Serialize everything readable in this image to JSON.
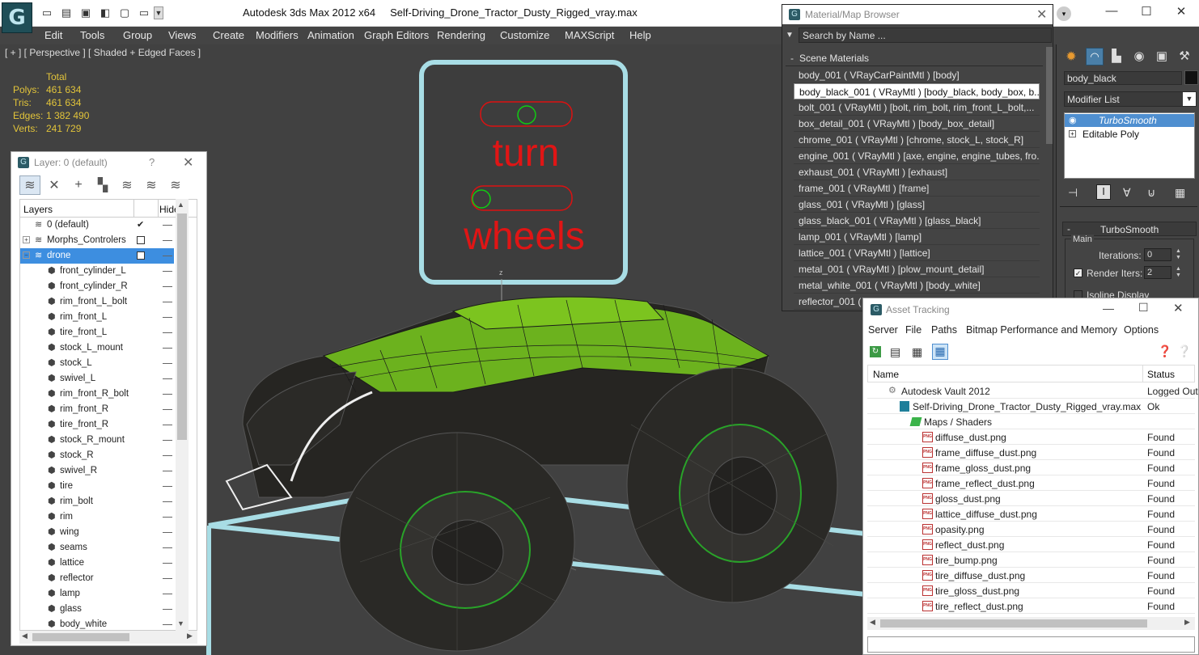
{
  "titlebar": {
    "app_title": "Autodesk 3ds Max  2012 x64",
    "file_name": "Self-Driving_Drone_Tractor_Dusty_Rigged_vray.max"
  },
  "menu": [
    "Edit",
    "Tools",
    "Group",
    "Views",
    "Create",
    "Modifiers",
    "Animation",
    "Graph Editors",
    "Rendering",
    "Customize",
    "MAXScript",
    "Help"
  ],
  "viewport": {
    "label": "[ + ] [ Perspective ] [ Shaded + Edged Faces ]",
    "stats_header": "Total",
    "stats": [
      {
        "label": "Polys:",
        "value": "461 634"
      },
      {
        "label": "Tris:",
        "value": "461 634"
      },
      {
        "label": "Edges:",
        "value": "1 382 490"
      },
      {
        "label": "Verts:",
        "value": "241 729"
      }
    ],
    "sign_line1": "turn",
    "sign_line2": "wheels",
    "axis_label": "z"
  },
  "layer_panel": {
    "title": "Layer: 0 (default)",
    "help": "?",
    "col_layers": "Layers",
    "col_hide": "Hide",
    "rows": [
      {
        "name": "0 (default)",
        "type": "layer",
        "check": true
      },
      {
        "name": "Morphs_Controlers",
        "type": "layer",
        "box": true,
        "expand": "+"
      },
      {
        "name": "drone",
        "type": "layer",
        "box": true,
        "expand": "−",
        "selected": true
      },
      {
        "name": "front_cylinder_L",
        "type": "obj"
      },
      {
        "name": "front_cylinder_R",
        "type": "obj"
      },
      {
        "name": "rim_front_L_bolt",
        "type": "obj"
      },
      {
        "name": "rim_front_L",
        "type": "obj"
      },
      {
        "name": "tire_front_L",
        "type": "obj"
      },
      {
        "name": "stock_L_mount",
        "type": "obj"
      },
      {
        "name": "stock_L",
        "type": "obj"
      },
      {
        "name": "swivel_L",
        "type": "obj"
      },
      {
        "name": "rim_front_R_bolt",
        "type": "obj"
      },
      {
        "name": "rim_front_R",
        "type": "obj"
      },
      {
        "name": "tire_front_R",
        "type": "obj"
      },
      {
        "name": "stock_R_mount",
        "type": "obj"
      },
      {
        "name": "stock_R",
        "type": "obj"
      },
      {
        "name": "swivel_R",
        "type": "obj"
      },
      {
        "name": "tire",
        "type": "obj"
      },
      {
        "name": "rim_bolt",
        "type": "obj"
      },
      {
        "name": "rim",
        "type": "obj"
      },
      {
        "name": "wing",
        "type": "obj"
      },
      {
        "name": "seams",
        "type": "obj"
      },
      {
        "name": "lattice",
        "type": "obj"
      },
      {
        "name": "reflector",
        "type": "obj"
      },
      {
        "name": "lamp",
        "type": "obj"
      },
      {
        "name": "glass",
        "type": "obj"
      },
      {
        "name": "body_white",
        "type": "obj"
      }
    ]
  },
  "material_browser": {
    "title": "Material/Map Browser",
    "search_placeholder": "Search by Name ...",
    "section": "Scene Materials",
    "rows": [
      "body_001  ( VRayCarPaintMtl )  [body]",
      "body_black_001  ( VRayMtl )  [body_black, body_box, b...",
      "bolt_001  ( VRayMtl )  [bolt, rim_bolt, rim_front_L_bolt,...",
      "box_detail_001  ( VRayMtl )  [body_box_detail]",
      "chrome_001  ( VRayMtl )  [chrome, stock_L, stock_R]",
      "engine_001  ( VRayMtl )  [axe, engine, engine_tubes, fro...",
      "exhaust_001  ( VRayMtl )  [exhaust]",
      "frame_001  ( VRayMtl )  [frame]",
      "glass_001  ( VRayMtl )  [glass]",
      "glass_black_001  ( VRayMtl )  [glass_black]",
      "lamp_001  ( VRayMtl )  [lamp]",
      "lattice_001  ( VRayMtl )  [lattice]",
      "metal_001  ( VRayMtl )  [plow_mount_detail]",
      "metal_white_001  ( VRayMtl )  [body_white]",
      "reflector_001  ( VRayMtl )  [reflector]"
    ]
  },
  "command_panel": {
    "object_name": "body_black",
    "modifier_list": "Modifier List",
    "stack": [
      "TurboSmooth",
      "Editable Poly"
    ],
    "rollout_title": "TurboSmooth",
    "group": "Main",
    "iterations_label": "Iterations:",
    "iterations_value": "0",
    "render_iters_label": "Render Iters:",
    "render_iters_value": "2",
    "isoline": "Isoline Display"
  },
  "asset_tracking": {
    "title": "Asset Tracking",
    "menu": [
      "Server",
      "File",
      "Paths",
      "Bitmap Performance and Memory",
      "Options"
    ],
    "col_name": "Name",
    "col_status": "Status",
    "rows": [
      {
        "name": "Autodesk Vault 2012",
        "status": "Logged Out",
        "indent": 0,
        "icon": "vault"
      },
      {
        "name": "Self-Driving_Drone_Tractor_Dusty_Rigged_vray.max",
        "status": "Ok",
        "indent": 1,
        "icon": "max"
      },
      {
        "name": "Maps / Shaders",
        "status": "",
        "indent": 2,
        "icon": "folder"
      },
      {
        "name": "diffuse_dust.png",
        "status": "Found",
        "indent": 3,
        "icon": "png"
      },
      {
        "name": "frame_diffuse_dust.png",
        "status": "Found",
        "indent": 3,
        "icon": "png"
      },
      {
        "name": "frame_gloss_dust.png",
        "status": "Found",
        "indent": 3,
        "icon": "png"
      },
      {
        "name": "frame_reflect_dust.png",
        "status": "Found",
        "indent": 3,
        "icon": "png"
      },
      {
        "name": "gloss_dust.png",
        "status": "Found",
        "indent": 3,
        "icon": "png"
      },
      {
        "name": "lattice_diffuse_dust.png",
        "status": "Found",
        "indent": 3,
        "icon": "png"
      },
      {
        "name": "opasity.png",
        "status": "Found",
        "indent": 3,
        "icon": "png"
      },
      {
        "name": "reflect_dust.png",
        "status": "Found",
        "indent": 3,
        "icon": "png"
      },
      {
        "name": "tire_bump.png",
        "status": "Found",
        "indent": 3,
        "icon": "png"
      },
      {
        "name": "tire_diffuse_dust.png",
        "status": "Found",
        "indent": 3,
        "icon": "png"
      },
      {
        "name": "tire_gloss_dust.png",
        "status": "Found",
        "indent": 3,
        "icon": "png"
      },
      {
        "name": "tire_reflect_dust.png",
        "status": "Found",
        "indent": 3,
        "icon": "png"
      }
    ]
  }
}
